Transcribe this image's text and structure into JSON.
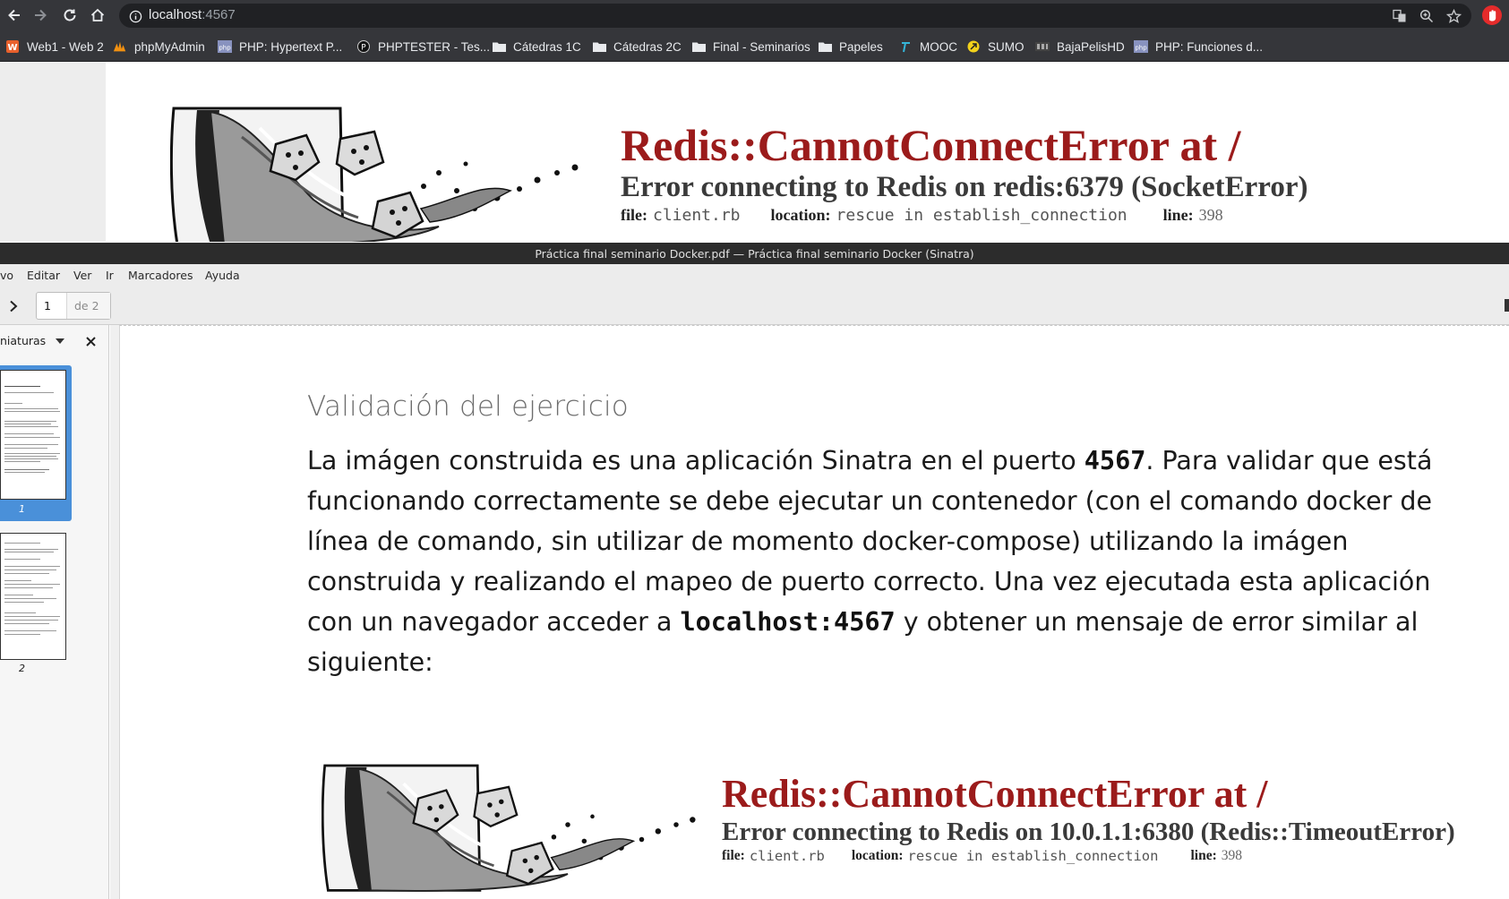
{
  "browser": {
    "url_host": "localhost",
    "url_port": ":4567",
    "bookmarks": [
      {
        "label": "Web1 - Web 2",
        "icon": "web-icon"
      },
      {
        "label": "phpMyAdmin",
        "icon": "phpmyadmin-icon"
      },
      {
        "label": "PHP: Hypertext P...",
        "icon": "php-icon"
      },
      {
        "label": "PHPTESTER - Tes...",
        "icon": "phptester-icon"
      },
      {
        "label": "Cátedras 1C",
        "icon": "folder-icon"
      },
      {
        "label": "Cátedras 2C",
        "icon": "folder-icon"
      },
      {
        "label": "Final - Seminarios",
        "icon": "folder-icon"
      },
      {
        "label": "Papeles",
        "icon": "folder-icon"
      },
      {
        "label": "MOOC",
        "icon": "mooc-icon"
      },
      {
        "label": "SUMO",
        "icon": "sumo-icon"
      },
      {
        "label": "BajaPelisHD",
        "icon": "bajapelis-icon"
      },
      {
        "label": "PHP: Funciones d...",
        "icon": "php-icon"
      }
    ]
  },
  "sinatra_error": {
    "title": "Redis::CannotConnectError at /",
    "message": "Error connecting to Redis on redis:6379 (SocketError)",
    "file_label": "file:",
    "file_value": "client.rb",
    "location_label": "location:",
    "location_value": "rescue in establish_connection",
    "line_label": "line:",
    "line_value": "398"
  },
  "evince": {
    "window_title": "Práctica final seminario Docker.pdf — Práctica final seminario Docker (Sinatra)",
    "menu": [
      "vo",
      "Editar",
      "Ver",
      "Ir",
      "Marcadores",
      "Ayuda"
    ],
    "page_current": "1",
    "page_of": "de 2",
    "sidebar_mode": "niaturas",
    "thumbnails": [
      {
        "label": "1"
      },
      {
        "label": "2"
      }
    ]
  },
  "pdf": {
    "heading": "Validación del ejercicio",
    "para_1": "La imágen construida es una aplicación Sinatra en el puerto ",
    "port_code": "4567",
    "para_2": ". Para validar que está funcionando correctamente se debe ejecutar un contenedor (con el comando docker de línea de comando, sin utilizar de momento docker-compose) utilizando la imágen construida y realizando el mapeo de puerto correcto. Una vez ejecutada esta aplicación con un navegador acceder a ",
    "host_code": "localhost:4567",
    "para_3": " y obtener un mensaje de error similar al siguiente:",
    "example_error": {
      "title": "Redis::CannotConnectError at /",
      "message": "Error connecting to Redis on 10.0.1.1:6380 (Redis::TimeoutError)",
      "file_label": "file:",
      "file_value": "client.rb",
      "location_label": "location:",
      "location_value": "rescue in establish_connection",
      "line_label": "line:",
      "line_value": "398"
    }
  }
}
